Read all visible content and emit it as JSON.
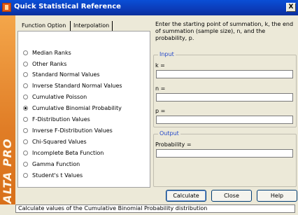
{
  "window": {
    "title": "Quick Statistical Reference",
    "close_symbol": "X"
  },
  "side_banner": {
    "text": "ALTA PRO"
  },
  "tabs": [
    {
      "label": "Function Option",
      "active": true
    },
    {
      "label": "Interpolation",
      "active": false
    }
  ],
  "options": [
    {
      "label": "Median Ranks",
      "checked": false
    },
    {
      "label": "Other Ranks",
      "checked": false
    },
    {
      "label": "Standard Normal Values",
      "checked": false
    },
    {
      "label": "Inverse Standard Normal Values",
      "checked": false
    },
    {
      "label": "Cumulative Poisson",
      "checked": false
    },
    {
      "label": "Cumulative Binomial Probability",
      "checked": true
    },
    {
      "label": "F-Distribution Values",
      "checked": false
    },
    {
      "label": "Inverse F-Distribution Values",
      "checked": false
    },
    {
      "label": "Chi-Squared Values",
      "checked": false
    },
    {
      "label": "Incomplete Beta Function",
      "checked": false
    },
    {
      "label": "Gamma Function",
      "checked": false
    },
    {
      "label": "Student's t Values",
      "checked": false
    }
  ],
  "instructions": "Enter the starting point of summation, k, the end of summation (sample size), n, and the probability, p.",
  "input_group": {
    "legend": "Input",
    "k_label": "k =",
    "k_value": "",
    "n_label": "n =",
    "n_value": "",
    "p_label": "p =",
    "p_value": ""
  },
  "output_group": {
    "legend": "Output",
    "probability_label": "Probability =",
    "probability_value": ""
  },
  "buttons": {
    "calculate": "Calculate",
    "close": "Close",
    "help": "Help"
  },
  "status": "Calculate values of the Cumulative Binomial Probability distribution"
}
